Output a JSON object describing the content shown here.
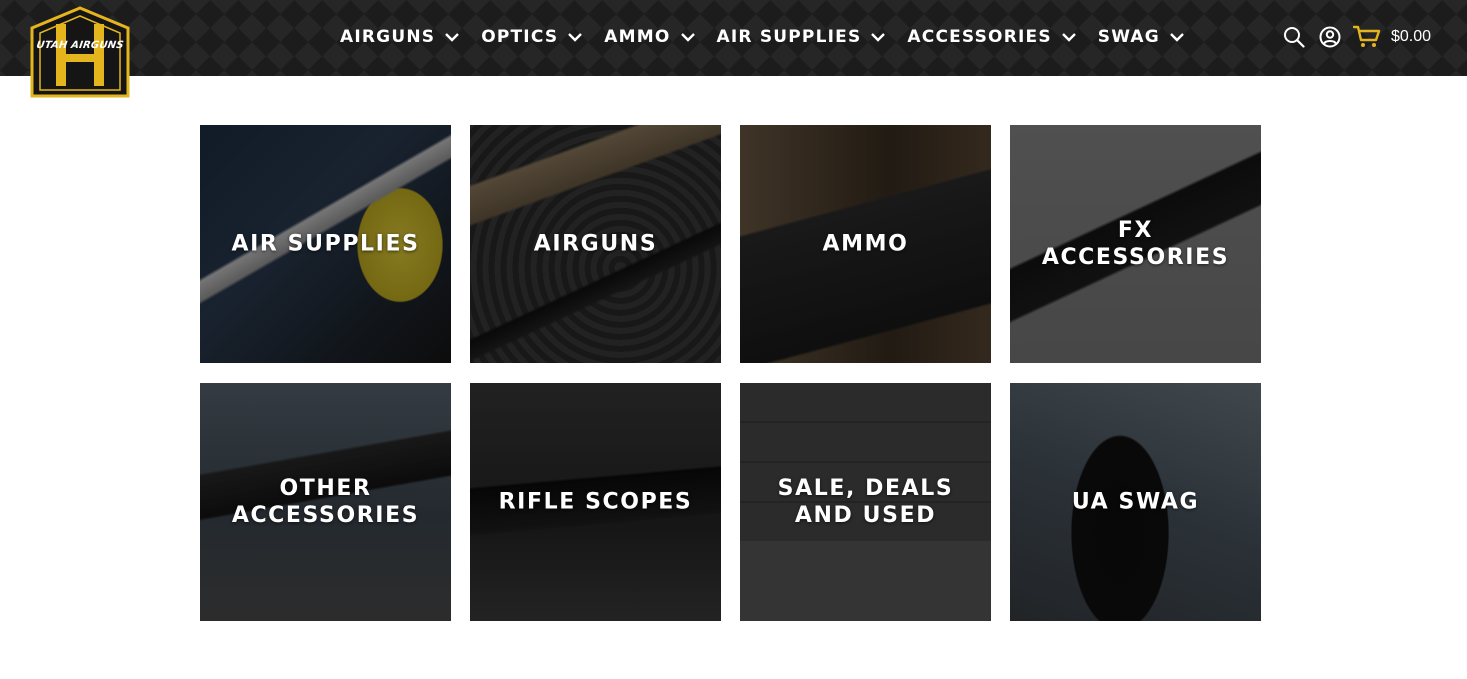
{
  "brand": {
    "logo_text": "UTAH AIRGUNS",
    "colors": {
      "gold": "#e5b51d",
      "header_bg": "#1c1c1c"
    }
  },
  "nav": {
    "items": [
      {
        "label": "AIRGUNS",
        "icon": "chevron-down-icon"
      },
      {
        "label": "OPTICS",
        "icon": "chevron-down-icon"
      },
      {
        "label": "AMMO",
        "icon": "chevron-down-icon"
      },
      {
        "label": "AIR SUPPLIES",
        "icon": "chevron-down-icon"
      },
      {
        "label": "ACCESSORIES",
        "icon": "chevron-down-icon"
      },
      {
        "label": "SWAG",
        "icon": "chevron-down-icon"
      }
    ]
  },
  "header_tools": {
    "search_icon": "search-icon",
    "account_icon": "user-circle-icon",
    "cart_icon": "shopping-cart-icon",
    "cart_total": "$0.00"
  },
  "categories": [
    {
      "label": "AIR SUPPLIES"
    },
    {
      "label": "AIRGUNS"
    },
    {
      "label": "AMMO"
    },
    {
      "label": "FX\nACCESSORIES"
    },
    {
      "label": "OTHER\nACCESSORIES"
    },
    {
      "label": "RIFLE SCOPES"
    },
    {
      "label": "SALE, DEALS\nAND USED"
    },
    {
      "label": "UA SWAG"
    }
  ]
}
